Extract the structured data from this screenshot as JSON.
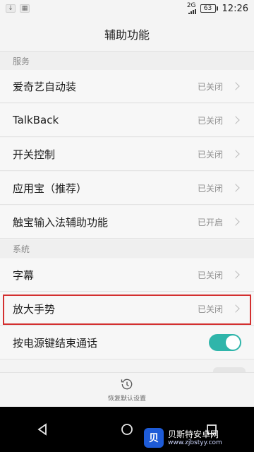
{
  "status_bar": {
    "network": "2G",
    "battery": "63",
    "time": "12:26"
  },
  "header": {
    "title": "辅助功能"
  },
  "sections": {
    "services": "服务",
    "system": "系统"
  },
  "rows": {
    "iqiyi": {
      "label": "爱奇艺自动装",
      "status": "已关闭"
    },
    "talkback": {
      "label": "TalkBack",
      "status": "已关闭"
    },
    "switch_control": {
      "label": "开关控制",
      "status": "已关闭"
    },
    "yingyongbao": {
      "label": "应用宝（推荐）",
      "status": "已关闭"
    },
    "chubao": {
      "label": "触宝输入法辅助功能",
      "status": "已开启"
    },
    "captions": {
      "label": "字幕",
      "status": "已关闭"
    },
    "magnify": {
      "label": "放大手势",
      "status": "已关闭"
    },
    "power_end_call": {
      "label": "按电源键结束通话",
      "toggle_on": true
    }
  },
  "footer": {
    "restore_label": "恢复默认设置"
  },
  "watermark": {
    "title": "贝斯特安卓网",
    "url": "www.zjbstyy.com"
  },
  "colors": {
    "toggle_on": "#2fb5aa",
    "highlight": "#d32f2f"
  }
}
